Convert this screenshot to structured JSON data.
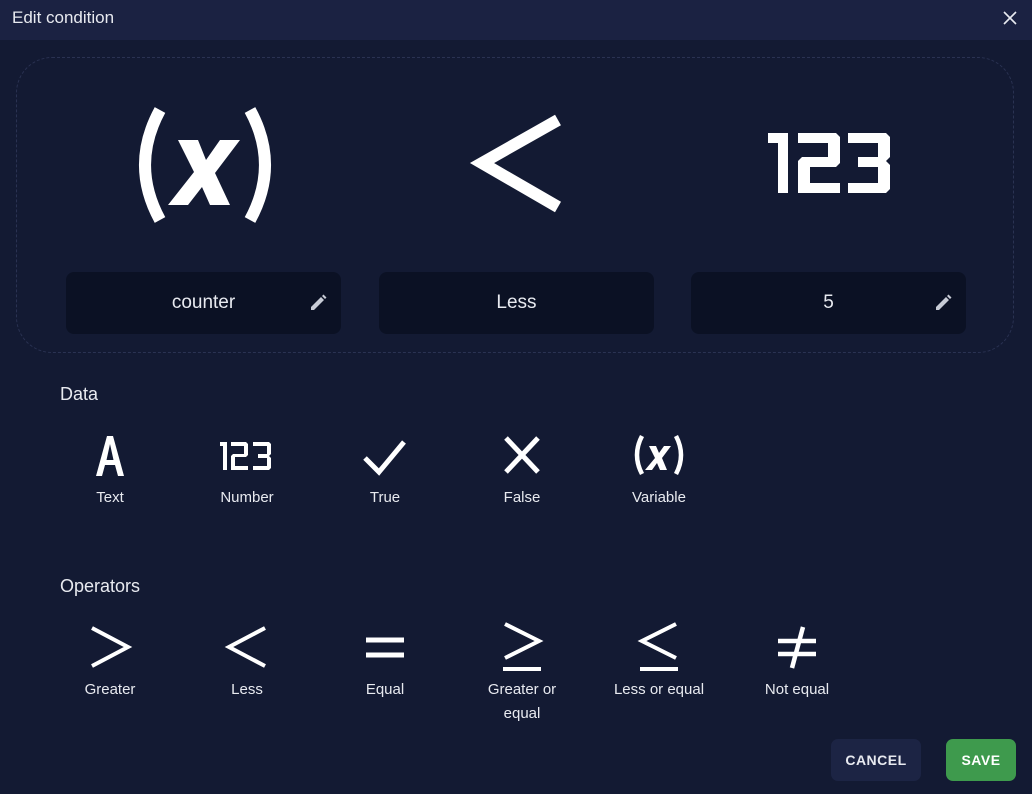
{
  "dialog": {
    "title": "Edit condition",
    "close_icon": "close-icon"
  },
  "condition": {
    "left": {
      "icon": "variable-icon",
      "value": "counter",
      "editable": true
    },
    "operator": {
      "icon": "less-icon",
      "value": "Less"
    },
    "right": {
      "icon": "number-icon",
      "value": "5",
      "editable": true
    }
  },
  "data_section": {
    "title": "Data",
    "items": [
      {
        "label": "Text",
        "icon": "text-icon"
      },
      {
        "label": "Number",
        "icon": "number-icon"
      },
      {
        "label": "True",
        "icon": "check-icon"
      },
      {
        "label": "False",
        "icon": "x-icon"
      },
      {
        "label": "Variable",
        "icon": "variable-icon"
      }
    ]
  },
  "operators_section": {
    "title": "Operators",
    "items": [
      {
        "label": "Greater",
        "icon": "greater-icon"
      },
      {
        "label": "Less",
        "icon": "less-icon"
      },
      {
        "label": "Equal",
        "icon": "equal-icon"
      },
      {
        "label": "Greater or equal",
        "icon": "greater-or-equal-icon"
      },
      {
        "label": "Less or equal",
        "icon": "less-or-equal-icon"
      },
      {
        "label": "Not equal",
        "icon": "not-equal-icon"
      }
    ]
  },
  "buttons": {
    "cancel": "CANCEL",
    "save": "SAVE"
  },
  "colors": {
    "background": "#131a33",
    "header": "#1b2242",
    "field": "#0b1124",
    "save": "#3e9a4d",
    "cancel": "#1c2444"
  }
}
